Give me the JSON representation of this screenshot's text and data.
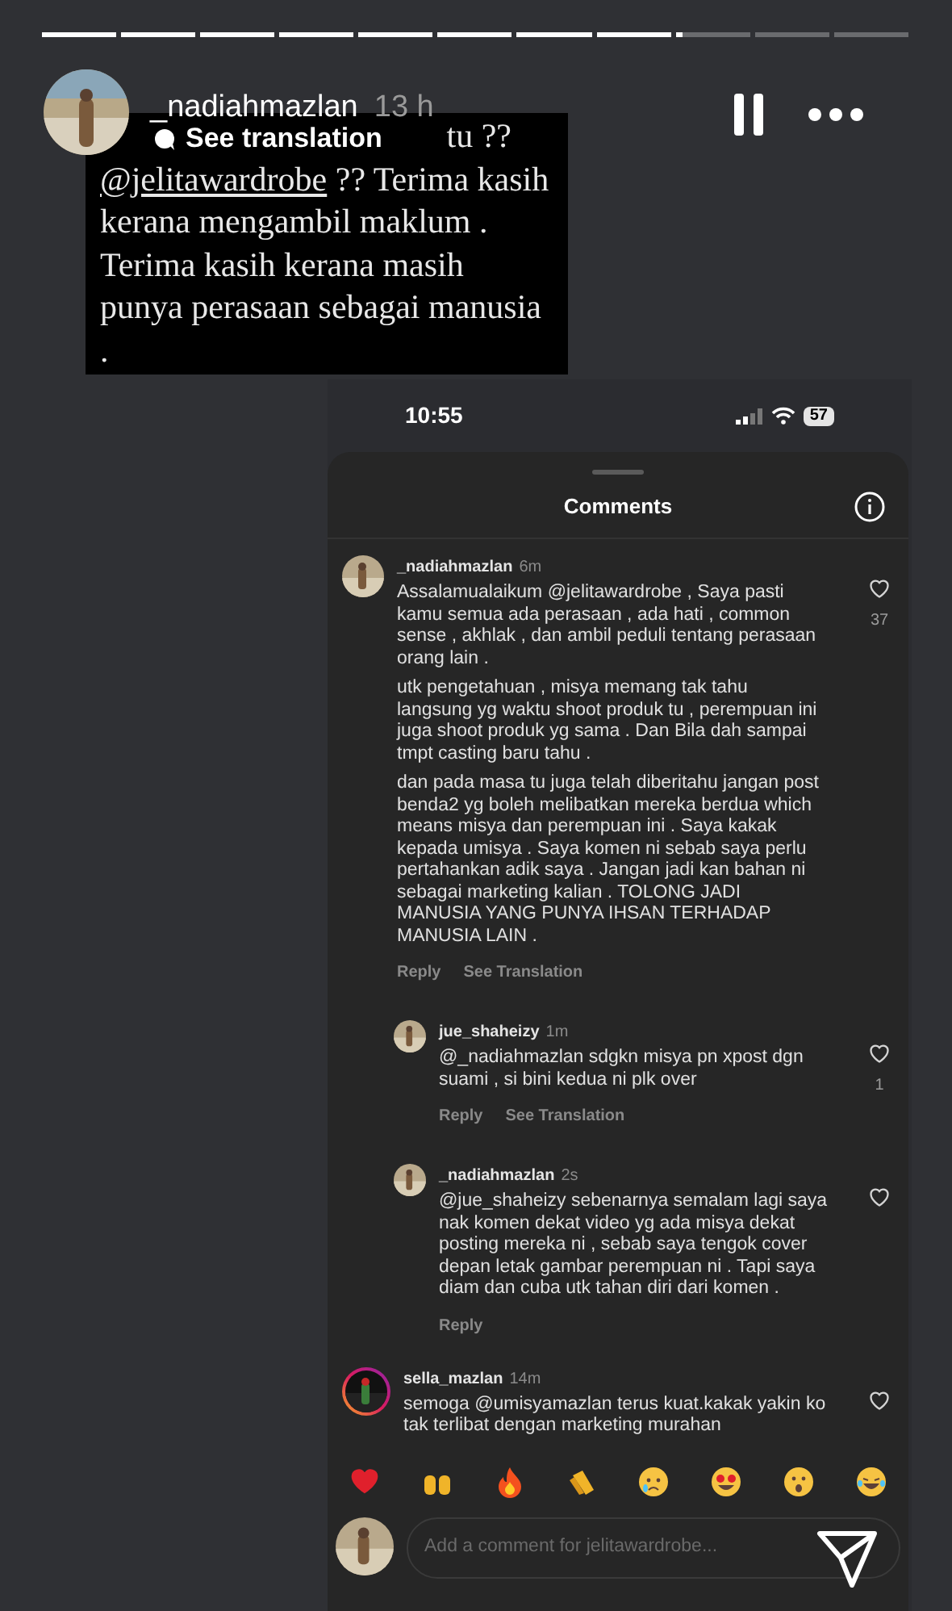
{
  "progress": {
    "level": 0.74
  },
  "header": {
    "username": "_nadiahmazlan",
    "time": "13 h",
    "paused": true
  },
  "caption": {
    "partial_line": "tu ??",
    "mention": "@jelitawardrobe",
    "text": " ?? Terima kasih kerana mengambil maklum . Terima kasih kerana masih punya perasaan sebagai manusia ."
  },
  "translation": {
    "label": "See translation"
  },
  "screenshot": {
    "status_bar": {
      "time": "10:55",
      "battery": "57"
    },
    "sheet": {
      "title": "Comments",
      "comments": [
        {
          "username": "_nadiahmazlan",
          "time": "6m",
          "paragraphs": [
            "Assalamualaikum @jelitawardrobe , Saya pasti kamu semua ada perasaan , ada hati , common sense , akhlak , dan ambil peduli tentang perasaan orang lain .",
            "utk pengetahuan , misya memang tak tahu langsung yg waktu shoot produk tu , perempuan ini juga shoot produk yg sama . Dan Bila dah sampai tmpt casting baru tahu .",
            "dan pada masa tu juga telah diberitahu jangan post benda2 yg boleh melibatkan mereka berdua which means misya dan perempuan ini . Saya kakak kepada umisya . Saya komen ni sebab saya perlu pertahankan adik saya . Jangan jadi kan bahan ni sebagai marketing kalian . TOLONG JADI MANUSIA YANG PUNYA IHSAN TERHADAP MANUSIA LAIN ."
          ],
          "likes": "37",
          "actions": [
            "Reply",
            "See Translation"
          ],
          "story_ring": false,
          "replies": [
            {
              "username": "jue_shaheizy",
              "time": "1m",
              "paragraphs": [
                "@_nadiahmazlan sdgkn misya pn xpost dgn suami , si bini kedua ni plk over"
              ],
              "likes": "1",
              "actions": [
                "Reply",
                "See Translation"
              ],
              "story_ring": false
            },
            {
              "username": "_nadiahmazlan",
              "time": "2s",
              "paragraphs": [
                "@jue_shaheizy sebenarnya semalam lagi saya nak komen dekat video yg ada misya dekat posting mereka ni , sebab saya tengok cover depan letak gambar perempuan ni . Tapi saya diam dan cuba utk tahan diri dari komen ."
              ],
              "actions": [
                "Reply"
              ],
              "story_ring": false
            }
          ]
        },
        {
          "username": "sella_mazlan",
          "time": "14m",
          "paragraphs": [
            "semoga @umisyamazlan terus kuat.kakak yakin ko tak terlibat dengan marketing murahan"
          ],
          "story_ring": true
        }
      ],
      "reactions": [
        {
          "kind": "heart"
        },
        {
          "kind": "raised-hands"
        },
        {
          "kind": "fire"
        },
        {
          "kind": "clap"
        },
        {
          "kind": "cry"
        },
        {
          "kind": "heart-eyes"
        },
        {
          "kind": "surprised"
        },
        {
          "kind": "laugh"
        }
      ],
      "composer": {
        "placeholder": "Add a comment for jelitawardrobe..."
      }
    }
  }
}
